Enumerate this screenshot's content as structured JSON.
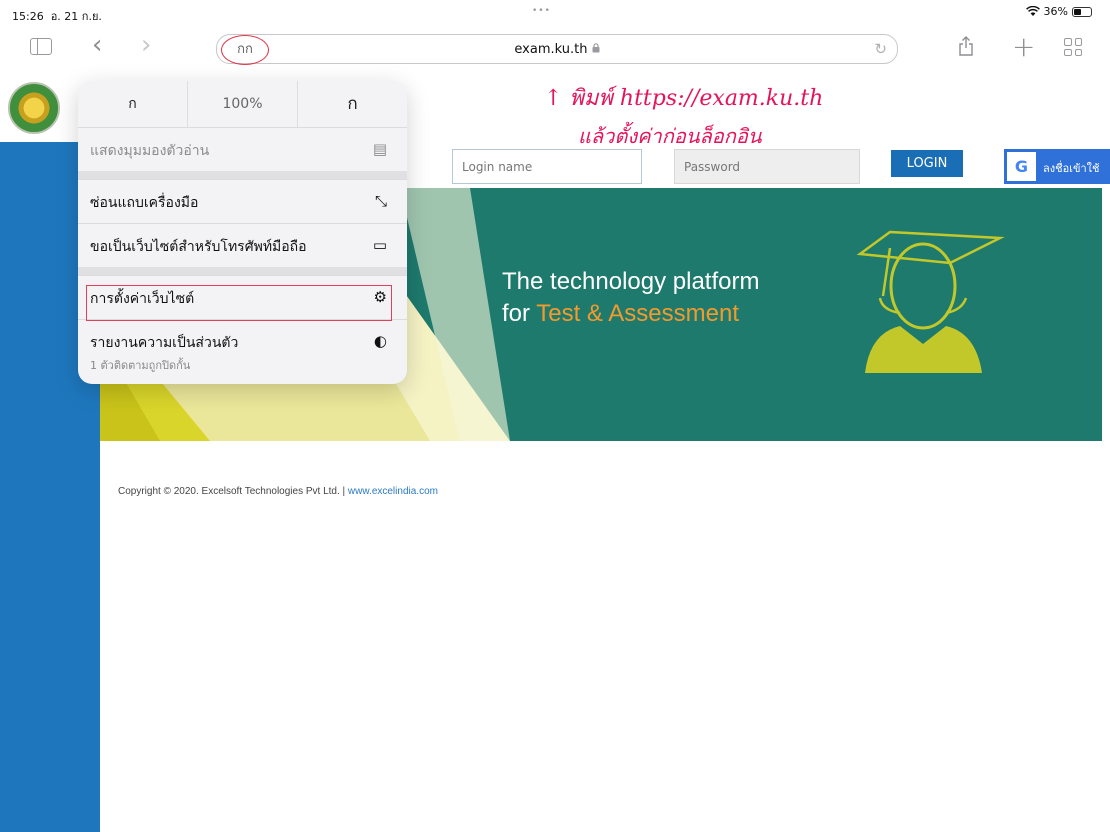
{
  "status_bar": {
    "time": "15:26",
    "date": "อ. 21 ก.ย.",
    "battery": "36%"
  },
  "toolbar": {
    "aa_label": "กก",
    "url": "exam.ku.th",
    "more_dots": "•••"
  },
  "menu": {
    "font_small": "ก",
    "zoom": "100%",
    "font_large": "ก",
    "reader_view": "แสดงมุมมองตัวอ่าน",
    "hide_toolbar": "ซ่อนแถบเครื่องมือ",
    "request_mobile": "ขอเป็นเว็บไซต์สำหรับโทรศัพท์มือถือ",
    "website_settings": "การตั้งค่าเว็บไซต์",
    "privacy_report": "รายงานความเป็นส่วนตัว",
    "privacy_sub": "1 ตัวติดตามถูกปิดกั้น"
  },
  "annotation": {
    "line1": "↑ พิมพ์ https://exam.ku.th",
    "line2": "แล้วตั้งค่าก่อนล็อกอิน"
  },
  "login": {
    "login_placeholder": "Login name",
    "password_placeholder": "Password",
    "login_button": "LOGIN",
    "google_label": "ลงชื่อเข้าใช้"
  },
  "banner": {
    "line1": "The technology platform",
    "line2_prefix": "for ",
    "line2_highlight": "Test & Assessment"
  },
  "footer": {
    "copyright": "Copyright © 2020. Excelsoft Technologies Pvt Ltd. | ",
    "link": "www.excelindia.com"
  },
  "colors": {
    "sidebar_blue": "#1e77bd",
    "banner_teal": "#1e7a6d",
    "orange": "#f39a2c",
    "login_blue": "#1a6eb5",
    "annotation_red": "#e5145a"
  }
}
